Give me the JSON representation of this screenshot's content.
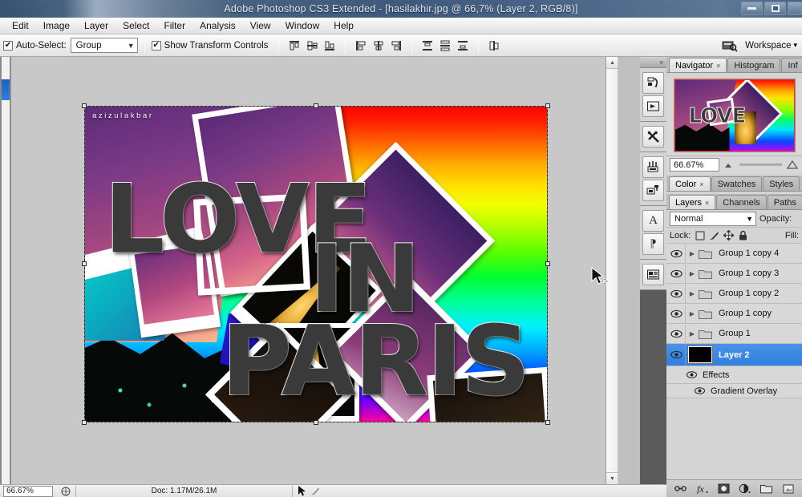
{
  "window": {
    "title": "Adobe Photoshop CS3 Extended - [hasilakhir.jpg @ 66,7% (Layer 2, RGB/8)]",
    "minimize_label": "Minimize",
    "maximize_label": "Restore",
    "close_label": "Close"
  },
  "menubar": {
    "items": [
      {
        "label": "Edit"
      },
      {
        "label": "Image"
      },
      {
        "label": "Layer"
      },
      {
        "label": "Select"
      },
      {
        "label": "Filter"
      },
      {
        "label": "Analysis"
      },
      {
        "label": "View"
      },
      {
        "label": "Window"
      },
      {
        "label": "Help"
      }
    ]
  },
  "options_bar": {
    "auto_select_label": "Auto-Select:",
    "auto_select_checked": "✔",
    "auto_select_value": "Group",
    "auto_select_caret": "▼",
    "show_transform_label": "Show Transform Controls",
    "show_transform_checked": "✔",
    "align_icons": [
      "align-top-edges-icon",
      "align-vertical-centers-icon",
      "align-bottom-edges-icon",
      "align-left-edges-icon",
      "align-horizontal-centers-icon",
      "align-right-edges-icon",
      "distribute-top-edges-icon",
      "distribute-vertical-centers-icon",
      "distribute-bottom-edges-icon",
      "distribute-left-edges-icon",
      "distribute-horizontal-centers-icon",
      "distribute-right-edges-icon",
      "auto-align-layers-icon"
    ],
    "bridge_label": "Go to Bridge",
    "workspace_label": "Workspace",
    "workspace_caret": "▾"
  },
  "document": {
    "watermark": "azizulakbar",
    "artwork_text_line1": "LOVE",
    "artwork_text_line2": "IN",
    "artwork_text_line3": "PARIS"
  },
  "navigator": {
    "tabs": [
      {
        "label": "Navigator",
        "active": true,
        "close": "×"
      },
      {
        "label": "Histogram",
        "active": false,
        "close": ""
      },
      {
        "label": "Inf",
        "active": false,
        "close": ""
      }
    ],
    "zoom_value": "66.67%",
    "zoom_out_icon": "small-mountain-icon",
    "zoom_in_icon": "large-mountain-icon"
  },
  "color_panel": {
    "tabs": [
      {
        "label": "Color",
        "active": true,
        "close": "×"
      },
      {
        "label": "Swatches",
        "active": false,
        "close": ""
      },
      {
        "label": "Styles",
        "active": false,
        "close": ""
      }
    ]
  },
  "layers_panel": {
    "tabs": [
      {
        "label": "Layers",
        "active": true,
        "close": "×"
      },
      {
        "label": "Channels",
        "active": false,
        "close": ""
      },
      {
        "label": "Paths",
        "active": false,
        "close": ""
      }
    ],
    "blend_mode": "Normal",
    "blend_caret": "▼",
    "opacity_label": "Opacity:",
    "lock_label": "Lock:",
    "fill_label": "Fill:",
    "lock_icons": [
      "lock-transparent-pixels-icon",
      "lock-image-pixels-icon",
      "lock-position-icon",
      "lock-all-icon"
    ],
    "rows": [
      {
        "name": "Group 1 copy 4",
        "type": "group",
        "visible": true,
        "selected": false,
        "expand": "▶"
      },
      {
        "name": "Group 1 copy 3",
        "type": "group",
        "visible": true,
        "selected": false,
        "expand": "▶"
      },
      {
        "name": "Group 1 copy 2",
        "type": "group",
        "visible": true,
        "selected": false,
        "expand": "▶"
      },
      {
        "name": "Group 1 copy",
        "type": "group",
        "visible": true,
        "selected": false,
        "expand": "▶"
      },
      {
        "name": "Group 1",
        "type": "group",
        "visible": true,
        "selected": false,
        "expand": "▶"
      },
      {
        "name": "Layer 2",
        "type": "layer",
        "visible": true,
        "selected": true,
        "expand": ""
      }
    ],
    "effects_label": "Effects",
    "effect_items": [
      {
        "name": "Gradient Overlay"
      }
    ],
    "footer_icons": [
      "link-layers-icon",
      "layer-style-fx-icon",
      "add-layer-mask-icon",
      "new-adjustment-layer-icon",
      "new-group-icon",
      "new-layer-icon"
    ]
  },
  "icon_dock": {
    "collapse_icon": "«",
    "buttons": [
      {
        "name": "history-panel-icon"
      },
      {
        "name": "actions-panel-icon"
      },
      {
        "name": "tool-presets-panel-icon"
      },
      {
        "name": "brushes-panel-icon"
      },
      {
        "name": "clone-source-panel-icon"
      },
      {
        "name": "character-panel-icon",
        "glyph": "A"
      },
      {
        "name": "paragraph-panel-icon",
        "glyph": "¶"
      },
      {
        "name": "layer-comps-panel-icon"
      }
    ]
  },
  "status_bar": {
    "zoom": "66.67%",
    "doc_info": "Doc: 1.17M/26.1M",
    "tool_hint": ""
  },
  "colors": {
    "titlebar": "#46627f",
    "selection_blue": "#2f7fdc",
    "panel_bg": "#d4d4d4",
    "canvas_bg": "#c8c8c8",
    "dock_bg": "#5b5b5b"
  }
}
